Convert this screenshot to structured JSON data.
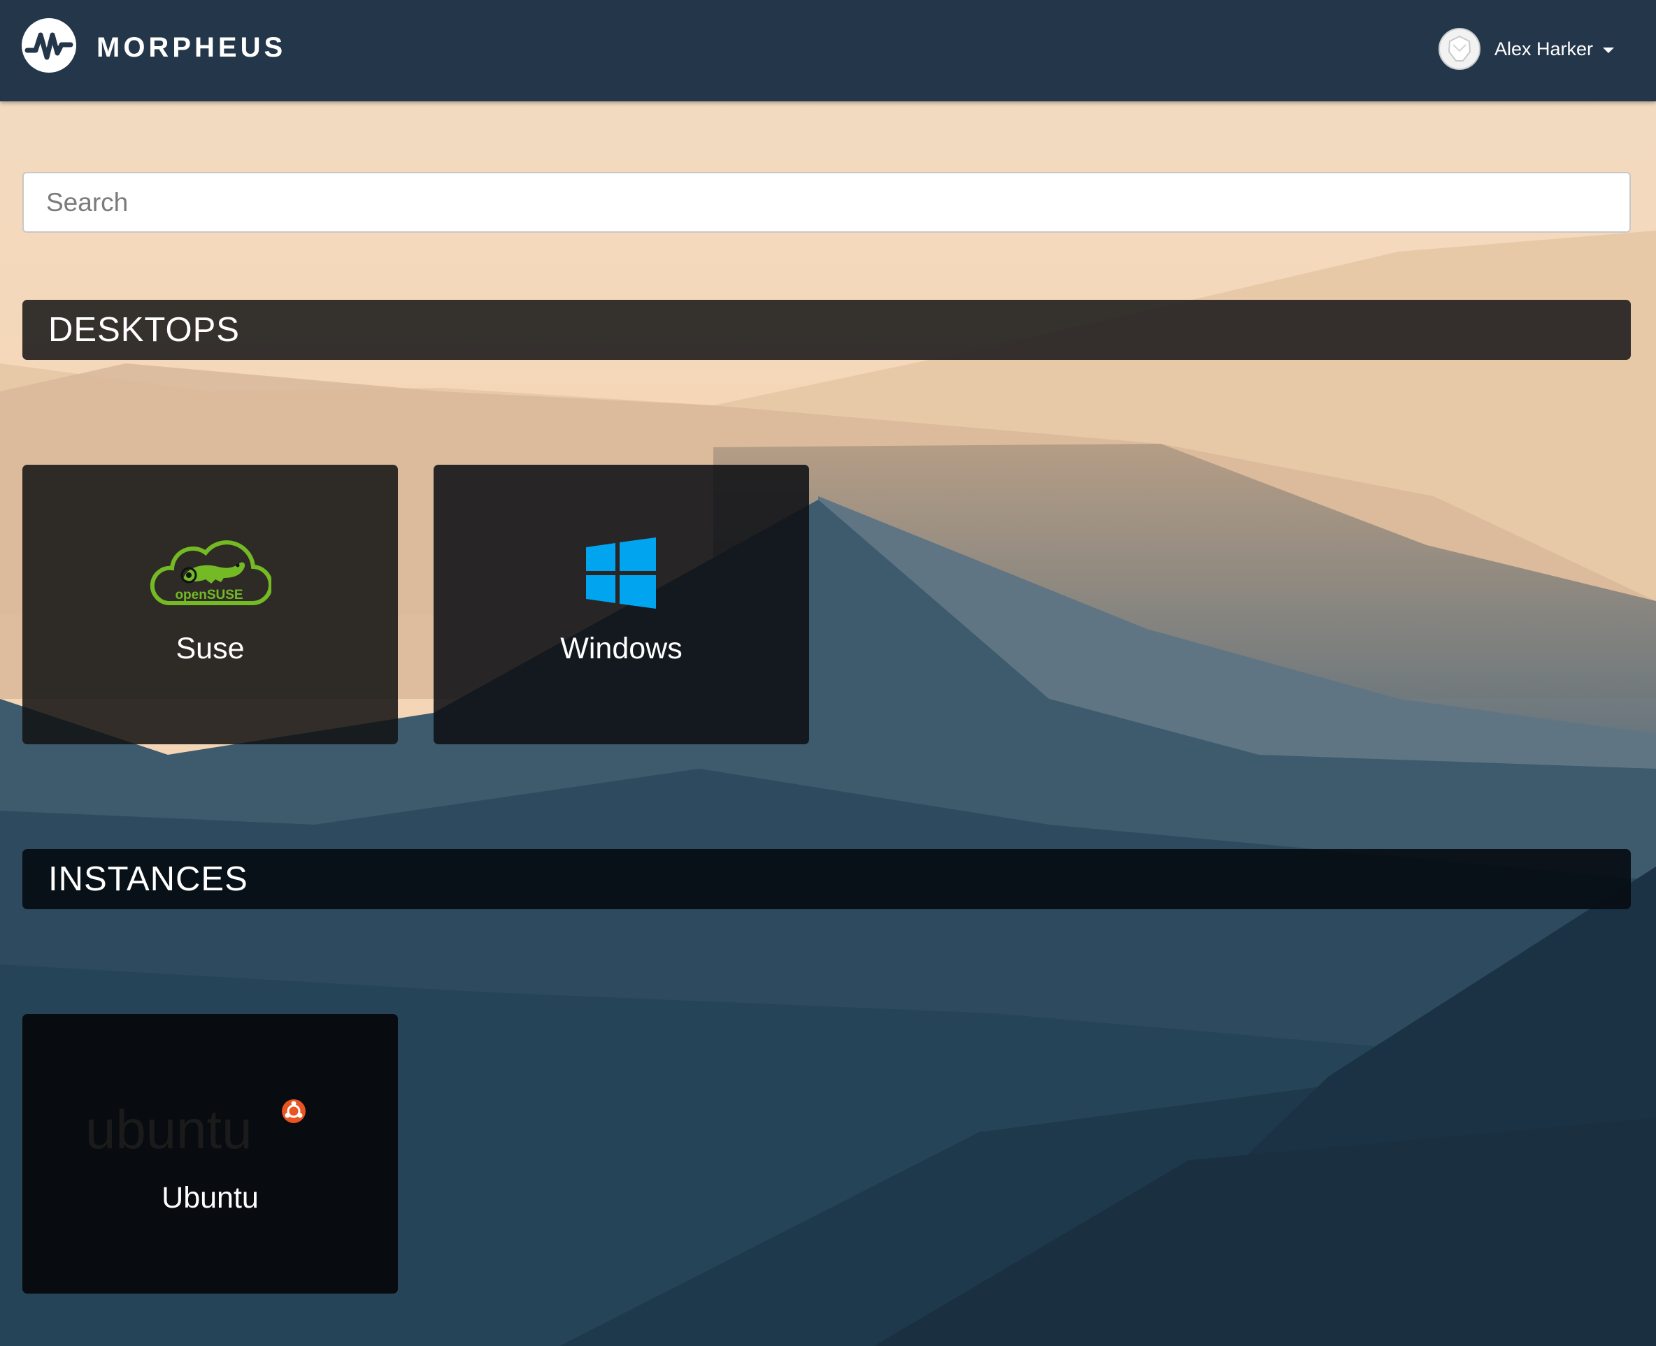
{
  "header": {
    "brand": "MORPHEUS",
    "user_name": "Alex Harker"
  },
  "search": {
    "placeholder": "Search",
    "value": ""
  },
  "sections": [
    {
      "title": "DESKTOPS",
      "tiles": [
        {
          "label": "Suse",
          "logo_text": "openSUSE"
        },
        {
          "label": "Windows"
        }
      ]
    },
    {
      "title": "INSTANCES",
      "tiles": [
        {
          "label": "Ubuntu",
          "logo_text": "ubuntu"
        }
      ]
    }
  ],
  "colors": {
    "topbar": "#243649",
    "suse_green": "#73ba25",
    "windows_blue": "#00a4ef",
    "ubuntu_orange": "#e95420"
  },
  "icons": [
    "morpheus-logo-icon",
    "avatar-icon",
    "chevron-down-icon",
    "opensuse-logo-icon",
    "windows-logo-icon",
    "ubuntu-logo-icon"
  ]
}
